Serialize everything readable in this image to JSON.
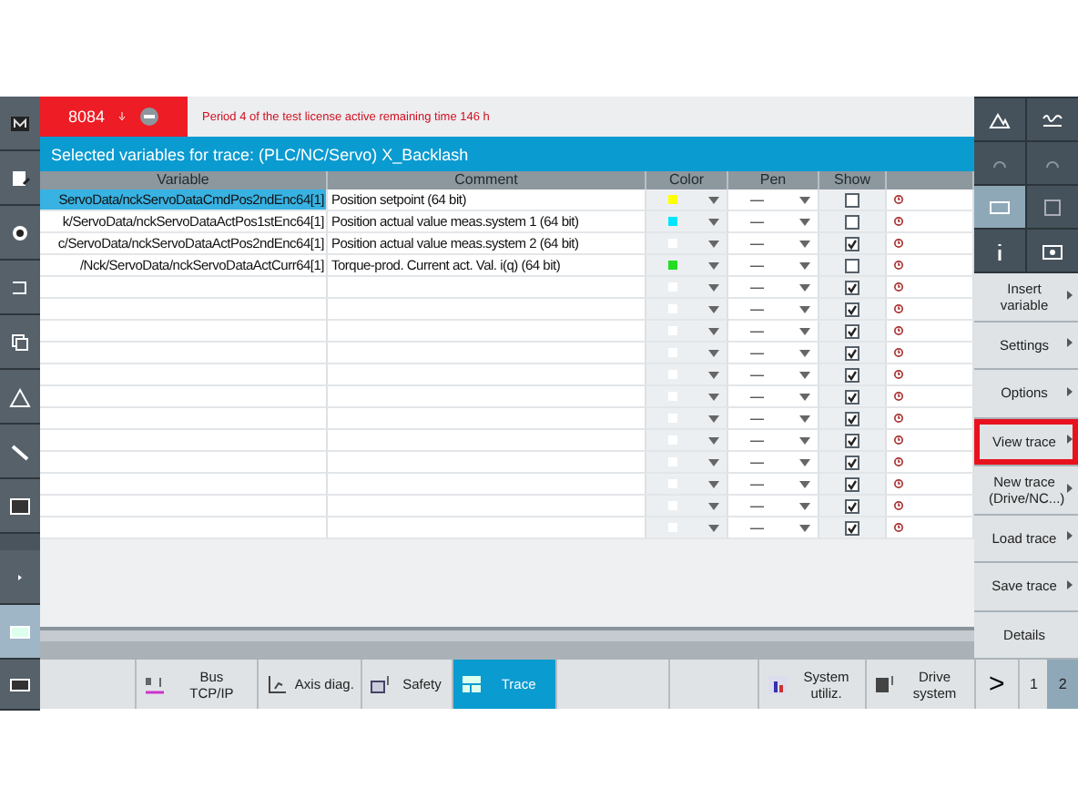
{
  "alarm": {
    "code": "8084",
    "message": "Period 4 of the test license active remaining time 146 h"
  },
  "title": "Selected variables for trace:  (PLC/NC/Servo) X_Backlash",
  "table": {
    "columns": [
      "Variable",
      "Comment",
      "Color",
      "Pen",
      "Show"
    ],
    "rows": [
      {
        "variable": "ServoData/nckServoDataCmdPos2ndEnc64[1]",
        "comment": "Position setpoint (64 bit)",
        "color": "#ffff00",
        "pen": "—",
        "show": false,
        "selected": true
      },
      {
        "variable": "k/ServoData/nckServoDataActPos1stEnc64[1]",
        "comment": "Position actual value meas.system 1 (64 bit)",
        "color": "#00e5ff",
        "pen": "—",
        "show": false,
        "selected": false
      },
      {
        "variable": "c/ServoData/nckServoDataActPos2ndEnc64[1]",
        "comment": "Position actual value meas.system 2 (64 bit)",
        "color": "#ffffff",
        "pen": "—",
        "show": true,
        "selected": false
      },
      {
        "variable": "/Nck/ServoData/nckServoDataActCurr64[1]",
        "comment": "Torque-prod. Current act. Val. i(q) (64 bit)",
        "color": "#22dd22",
        "pen": "—",
        "show": false,
        "selected": false
      },
      {
        "variable": "",
        "comment": "",
        "color": "#ffffff",
        "pen": "—",
        "show": true,
        "selected": false
      },
      {
        "variable": "",
        "comment": "",
        "color": "#ffffff",
        "pen": "—",
        "show": true,
        "selected": false
      },
      {
        "variable": "",
        "comment": "",
        "color": "#ffffff",
        "pen": "—",
        "show": true,
        "selected": false
      },
      {
        "variable": "",
        "comment": "",
        "color": "#ffffff",
        "pen": "—",
        "show": true,
        "selected": false
      },
      {
        "variable": "",
        "comment": "",
        "color": "#ffffff",
        "pen": "—",
        "show": true,
        "selected": false
      },
      {
        "variable": "",
        "comment": "",
        "color": "#ffffff",
        "pen": "—",
        "show": true,
        "selected": false
      },
      {
        "variable": "",
        "comment": "",
        "color": "#ffffff",
        "pen": "—",
        "show": true,
        "selected": false
      },
      {
        "variable": "",
        "comment": "",
        "color": "#ffffff",
        "pen": "—",
        "show": true,
        "selected": false
      },
      {
        "variable": "",
        "comment": "",
        "color": "#ffffff",
        "pen": "—",
        "show": true,
        "selected": false
      },
      {
        "variable": "",
        "comment": "",
        "color": "#ffffff",
        "pen": "—",
        "show": true,
        "selected": false
      },
      {
        "variable": "",
        "comment": "",
        "color": "#ffffff",
        "pen": "—",
        "show": true,
        "selected": false
      },
      {
        "variable": "",
        "comment": "",
        "color": "#ffffff",
        "pen": "—",
        "show": true,
        "selected": false
      }
    ]
  },
  "softkeys": [
    {
      "label": "Insert variable",
      "arrow": true,
      "highlighted": false
    },
    {
      "label": "Settings",
      "arrow": true,
      "highlighted": false
    },
    {
      "label": "Options",
      "arrow": true,
      "highlighted": false
    },
    {
      "label": "View trace",
      "arrow": true,
      "highlighted": true
    },
    {
      "label": "New trace (Drive/NC...)",
      "arrow": true,
      "highlighted": false
    },
    {
      "label": "Load trace",
      "arrow": true,
      "highlighted": false
    },
    {
      "label": "Save trace",
      "arrow": true,
      "highlighted": false
    },
    {
      "label": "Details",
      "arrow": false,
      "highlighted": false
    }
  ],
  "bottom_tabs": [
    {
      "label": "Bus TCP/IP",
      "selected": false
    },
    {
      "label": "Axis diag.",
      "selected": false
    },
    {
      "label": "Safety",
      "selected": false
    },
    {
      "label": "Trace",
      "selected": true
    },
    {
      "label": "System utiliz.",
      "selected": false
    },
    {
      "label": "Drive system",
      "selected": false
    }
  ],
  "next": ">",
  "pages": [
    {
      "label": "1",
      "selected": false
    },
    {
      "label": "2",
      "selected": true
    }
  ]
}
